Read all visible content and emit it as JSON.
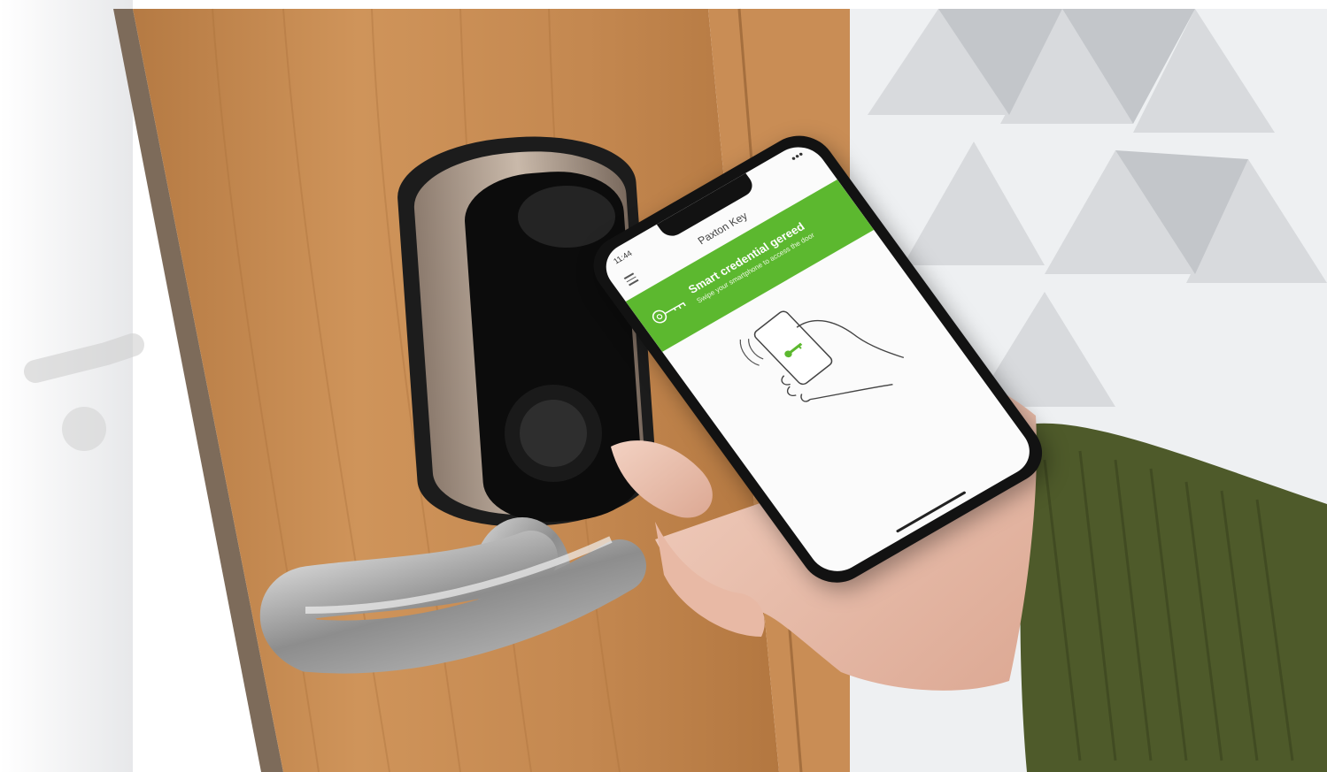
{
  "app": {
    "status_time": "11:44",
    "title": "Paxton Key",
    "banner_title": "Smart credential gereed",
    "banner_subtitle": "Swipe your smartphone to access the door"
  },
  "colors": {
    "banner_green": "#5cb82f",
    "door_wood": "#c68b52",
    "sleeve_green": "#4e5a2a",
    "phone_body": "#121212"
  },
  "icons": {
    "menu": "hamburger-menu-icon",
    "key": "key-icon",
    "illustration": "hand-holding-phone-icon"
  }
}
